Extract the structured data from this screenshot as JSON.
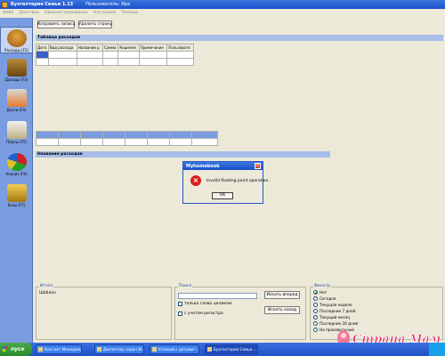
{
  "window": {
    "title": "Бухгалтерия Семьи 1.13",
    "user_label": "Пользователь: Ира"
  },
  "menu": [
    "Файл",
    "Действия",
    "Администрирование",
    "Настройки",
    "Помощь"
  ],
  "sidebar": {
    "items": [
      {
        "label": "Расходы (F2)",
        "icon": "expenses-icon",
        "active": true
      },
      {
        "label": "Доходы (F3)",
        "icon": "income-icon",
        "active": false
      },
      {
        "label": "Долги (F4)",
        "icon": "debts-icon",
        "active": false
      },
      {
        "label": "Планы (F5)",
        "icon": "plans-icon",
        "active": false
      },
      {
        "label": "Анализ (F6)",
        "icon": "analysis-icon",
        "active": false
      },
      {
        "label": "Базы (F7)",
        "icon": "bases-icon",
        "active": false
      }
    ]
  },
  "toolbar": {
    "edit_record": "Исправить запись",
    "delete_row": "Удалить строку"
  },
  "expenses_table": {
    "header": "Таблица расходов",
    "columns": [
      "Дата",
      "Вид расхода",
      "Название р",
      "Сумма",
      "Кошелек",
      "Примечание",
      "Пользовате"
    ]
  },
  "names_section": {
    "header": "Название расходов"
  },
  "dialog": {
    "title": "Myhomebook",
    "message": "Invalid floating point operation.",
    "ok": "OK"
  },
  "totals_panel": {
    "title": "Итоги",
    "text": "Шаблон"
  },
  "search_panel": {
    "title": "Поиск",
    "search_forward": "Искать вперед",
    "search_back": "Искать назад",
    "whole_word": "только слово целиком",
    "match_case": "с учетом регистра"
  },
  "filter_panel": {
    "title": "Фильтр",
    "options": [
      {
        "label": "Нет",
        "selected": true
      },
      {
        "label": "Сегодня",
        "selected": false
      },
      {
        "label": "Текущая неделя",
        "selected": false
      },
      {
        "label": "Последние 7 дней",
        "selected": false
      },
      {
        "label": "Текущий месяц",
        "selected": false
      },
      {
        "label": "Последние 30 дней",
        "selected": false
      },
      {
        "label": "На произвольный",
        "selected": false
      }
    ]
  },
  "taskbar": {
    "start": "пуск",
    "tasks": [
      {
        "label": "Контакт Менеджер",
        "active": false
      },
      {
        "label": "Диспетчер задач W...",
        "active": false
      },
      {
        "label": "Успевай с детьми! -...",
        "active": false
      },
      {
        "label": "Бухгалтерия Семьи ...",
        "active": true
      }
    ]
  },
  "watermark": "Страна Мам"
}
